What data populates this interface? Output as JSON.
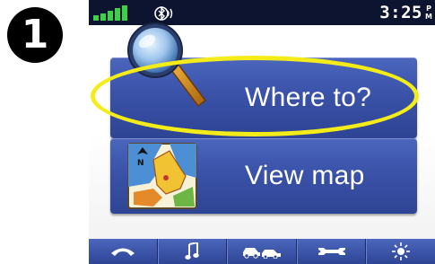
{
  "step": {
    "number": "1"
  },
  "status": {
    "time": "3:25",
    "meridiem_top": "P",
    "meridiem_bottom": "M",
    "signal_icon": "gps-signal-icon",
    "bluetooth_icon": "bluetooth-icon"
  },
  "menu": {
    "where_to": {
      "label": "Where to?",
      "icon": "magnifier-icon"
    },
    "view_map": {
      "label": "View map",
      "icon": "map-icon"
    }
  },
  "toolbar": [
    {
      "name": "phone",
      "icon": "phone-icon"
    },
    {
      "name": "music",
      "icon": "music-note-icon"
    },
    {
      "name": "traffic",
      "icon": "traffic-icon"
    },
    {
      "name": "tools",
      "icon": "wrench-icon"
    },
    {
      "name": "brightness",
      "icon": "brightness-icon"
    }
  ],
  "colors": {
    "button_blue": "#3a52a8",
    "status_bar": "#0d1430",
    "highlight": "#f4ec18",
    "signal_green": "#3fd04a"
  }
}
